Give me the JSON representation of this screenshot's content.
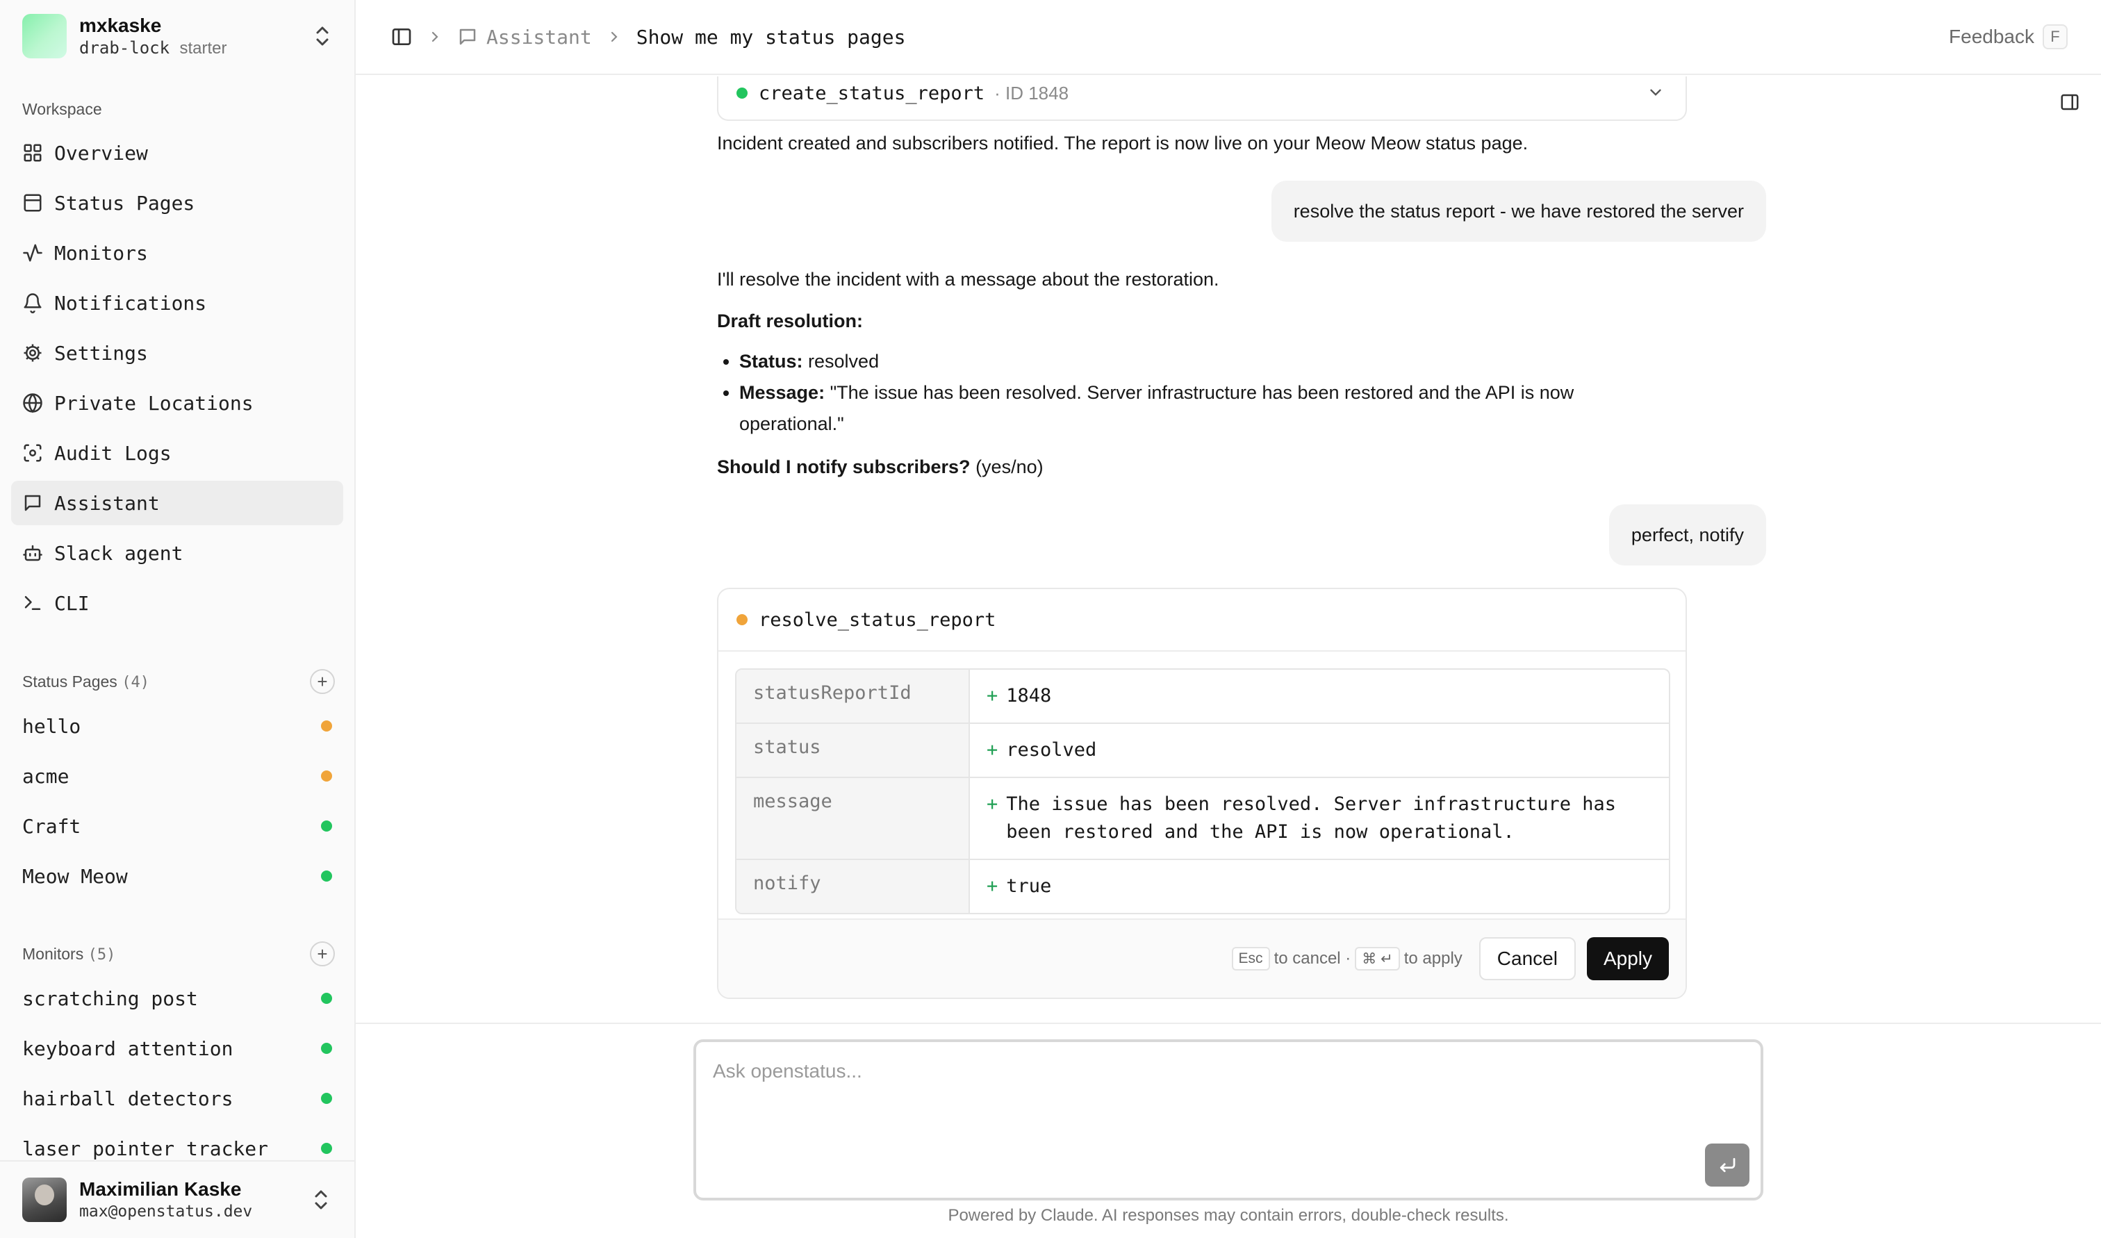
{
  "workspace": {
    "name": "mxkaske",
    "slug": "drab-lock",
    "plan": "starter"
  },
  "sidebar": {
    "section_label": "Workspace",
    "items": [
      {
        "label": "Overview",
        "icon": "grid-icon"
      },
      {
        "label": "Status Pages",
        "icon": "layout-icon"
      },
      {
        "label": "Monitors",
        "icon": "activity-icon"
      },
      {
        "label": "Notifications",
        "icon": "bell-icon"
      },
      {
        "label": "Settings",
        "icon": "gear-icon"
      },
      {
        "label": "Private Locations",
        "icon": "globe-icon"
      },
      {
        "label": "Audit Logs",
        "icon": "scan-icon"
      },
      {
        "label": "Assistant",
        "icon": "chat-icon",
        "active": true
      },
      {
        "label": "Slack agent",
        "icon": "bot-icon"
      },
      {
        "label": "CLI",
        "icon": "terminal-icon"
      }
    ],
    "status_pages": {
      "label": "Status Pages",
      "count": "(4)",
      "items": [
        {
          "label": "hello",
          "status": "orange"
        },
        {
          "label": "acme",
          "status": "orange"
        },
        {
          "label": "Craft",
          "status": "green"
        },
        {
          "label": "Meow Meow",
          "status": "green"
        }
      ]
    },
    "monitors": {
      "label": "Monitors",
      "count": "(5)",
      "items": [
        {
          "label": "scratching post",
          "status": "green"
        },
        {
          "label": "keyboard attention",
          "status": "green"
        },
        {
          "label": "hairball detectors",
          "status": "green"
        },
        {
          "label": "laser pointer tracker",
          "status": "green"
        }
      ]
    }
  },
  "user": {
    "name": "Maximilian Kaske",
    "email": "max@openstatus.dev"
  },
  "breadcrumb": {
    "section": "Assistant",
    "page": "Show me my status pages"
  },
  "feedback": {
    "label": "Feedback",
    "shortcut": "F"
  },
  "colors": {
    "orange": "#f0a43a",
    "green": "#22c55e",
    "apply_bg": "#111111"
  },
  "chat": {
    "prev_tool": {
      "name": "create_status_report",
      "id": "· ID 1848",
      "status": "green"
    },
    "msg1": "Incident created and subscribers notified. The report is now live on your Meow Meow status page.",
    "user1": "resolve the status report - we have restored the server",
    "msg2": "I'll resolve the incident with a message about the restoration.",
    "draft_heading": "Draft resolution:",
    "draft": [
      {
        "key": "Status:",
        "value": "resolved"
      },
      {
        "key": "Message:",
        "value": "\"The issue has been resolved. Server infrastructure has been restored and the API is now operational.\""
      }
    ],
    "question_bold": "Should I notify subscribers?",
    "question_rest": "(yes/no)",
    "user2": "perfect, notify",
    "tool": {
      "name": "resolve_status_report",
      "status": "orange",
      "args": [
        {
          "key": "statusReportId",
          "value": "1848"
        },
        {
          "key": "status",
          "value": "resolved"
        },
        {
          "key": "message",
          "value": "The issue has been resolved. Server infrastructure has been restored and the API is now operational."
        },
        {
          "key": "notify",
          "value": "true"
        }
      ],
      "hint_esc": "Esc",
      "hint_cancel": "to cancel ·",
      "hint_cmd": "⌘ ↵",
      "hint_apply": "to apply",
      "cancel_label": "Cancel",
      "apply_label": "Apply"
    }
  },
  "composer": {
    "placeholder": "Ask openstatus...",
    "value": ""
  },
  "disclaimer": "Powered by Claude. AI responses may contain errors, double-check results."
}
